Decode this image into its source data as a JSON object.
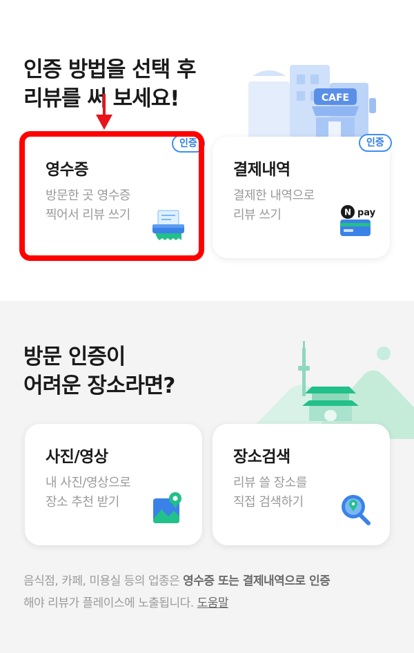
{
  "verify_section": {
    "heading_line1": "인증 방법을 선택 후",
    "heading_line2": "리뷰를 써 보세요!",
    "illustration_sign": "CAFE",
    "receipt_card": {
      "title": "영수증",
      "desc_line1": "방문한 곳 영수증",
      "desc_line2": "찍어서 리뷰 쓰기",
      "badge": "인증",
      "icon": "receipt-scanner-icon"
    },
    "payment_card": {
      "title": "결제내역",
      "desc_line1": "결제한 내역으로",
      "desc_line2": "리뷰 쓰기",
      "badge": "인증",
      "pay_brand": "pay",
      "icon": "npay-card-icon"
    }
  },
  "no_verify_section": {
    "heading_line1": "방문 인증이",
    "heading_line2": "어려운 장소라면?",
    "photo_card": {
      "title": "사진/영상",
      "desc_line1": "내 사진/영상으로",
      "desc_line2": "장소 추천 받기",
      "icon": "photo-location-icon"
    },
    "search_card": {
      "title": "장소검색",
      "desc_line1": "리뷰 쓸 장소를",
      "desc_line2": "직접 검색하기",
      "icon": "search-location-icon"
    }
  },
  "footer_note": {
    "part1": "음식점, 카페, 미용실 등의 업종은 ",
    "bold": "영수증 또는 결제내역으로 인증",
    "line2": "해야 리뷰가 플레이스에 노출됩니다. ",
    "help_link": "도움말"
  },
  "colors": {
    "badge_blue": "#2f7de6",
    "highlight_red": "#ff0000",
    "accent_green": "#22c08a",
    "section2_bg": "#f4f4f4"
  }
}
